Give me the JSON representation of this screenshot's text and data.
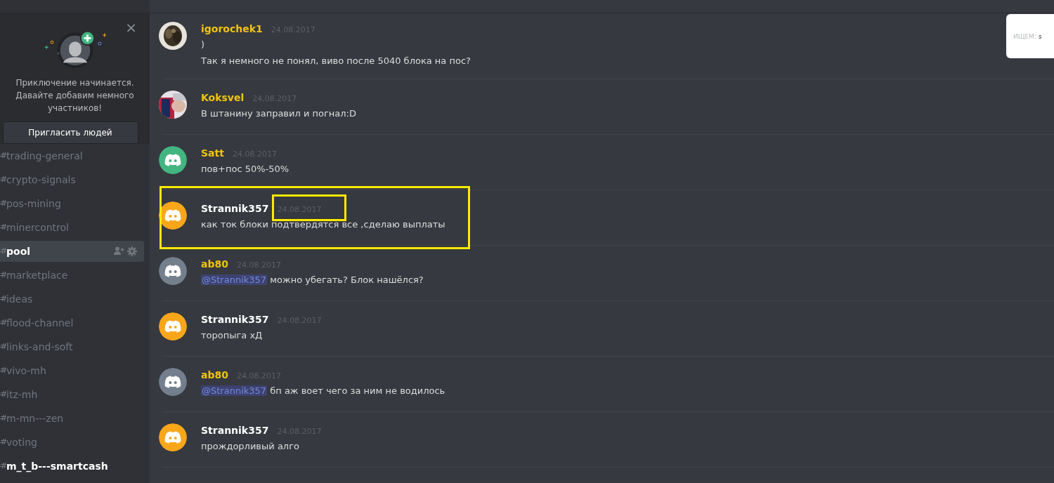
{
  "invite_card": {
    "text": "Приключение начинается. Давайте добавим немного участников!",
    "button": "Пригласить людей",
    "close": "×"
  },
  "channels": [
    {
      "name": "trading-general",
      "selected": false,
      "unread": false
    },
    {
      "name": "crypto-signals",
      "selected": false,
      "unread": false
    },
    {
      "name": "pos-mining",
      "selected": false,
      "unread": false
    },
    {
      "name": "minercontrol",
      "selected": false,
      "unread": false
    },
    {
      "name": "pool",
      "selected": true,
      "unread": false
    },
    {
      "name": "marketplace",
      "selected": false,
      "unread": false
    },
    {
      "name": "ideas",
      "selected": false,
      "unread": false
    },
    {
      "name": "flood-channel",
      "selected": false,
      "unread": false
    },
    {
      "name": "links-and-soft",
      "selected": false,
      "unread": false
    },
    {
      "name": "vivo-mh",
      "selected": false,
      "unread": false
    },
    {
      "name": "itz-mh",
      "selected": false,
      "unread": false
    },
    {
      "name": "m-mn---zen",
      "selected": false,
      "unread": false
    },
    {
      "name": "voting",
      "selected": false,
      "unread": false
    },
    {
      "name": "m_t_b---smartcash",
      "selected": false,
      "unread": true
    }
  ],
  "messages": [
    {
      "author": "igorochek1",
      "color": "#f1c40f",
      "time": "24.08.2017",
      "avatar": {
        "kind": "picture"
      },
      "lines": [
        ")",
        "Так я немного не понял, виво после 5040 блока на пос?"
      ],
      "highlighted": false
    },
    {
      "author": "Koksvel",
      "color": "#f1c40f",
      "time": "24.08.2017",
      "avatar": {
        "kind": "picture"
      },
      "lines": [
        "В штанину заправил и погнал:D"
      ],
      "highlighted": false
    },
    {
      "author": "Satt",
      "color": "#f1c40f",
      "time": "24.08.2017",
      "avatar": {
        "kind": "logo",
        "color": "#43b581"
      },
      "lines": [
        "пов+пос 50%-50%"
      ],
      "highlighted": false
    },
    {
      "author": "Strannik357",
      "color": "#ffffff",
      "time": "24.08.2017",
      "avatar": {
        "kind": "logo",
        "color": "#faa61a"
      },
      "lines": [
        "как ток блоки подтвердятся все ,сделаю выплаты"
      ],
      "highlighted": true
    },
    {
      "author": "ab80",
      "color": "#f1c40f",
      "time": "24.08.2017",
      "avatar": {
        "kind": "logo",
        "color": "#747f8d"
      },
      "mention": "@Strannik357",
      "lines": [
        "можно убегать? Блок нашёлся?"
      ],
      "highlighted": false
    },
    {
      "author": "Strannik357",
      "color": "#ffffff",
      "time": "24.08.2017",
      "avatar": {
        "kind": "logo",
        "color": "#faa61a"
      },
      "lines": [
        "торопыга хД"
      ],
      "highlighted": false
    },
    {
      "author": "ab80",
      "color": "#f1c40f",
      "time": "24.08.2017",
      "avatar": {
        "kind": "logo",
        "color": "#747f8d"
      },
      "mention": "@Strannik357",
      "lines": [
        "бп аж воет чего за ним не водилось"
      ],
      "highlighted": false
    },
    {
      "author": "Strannik357",
      "color": "#ffffff",
      "time": "24.08.2017",
      "avatar": {
        "kind": "logo",
        "color": "#faa61a"
      },
      "lines": [
        "прождорливый алго"
      ],
      "highlighted": false
    }
  ],
  "search_popup": {
    "label": "ИЩЕМ:",
    "value": "s"
  }
}
